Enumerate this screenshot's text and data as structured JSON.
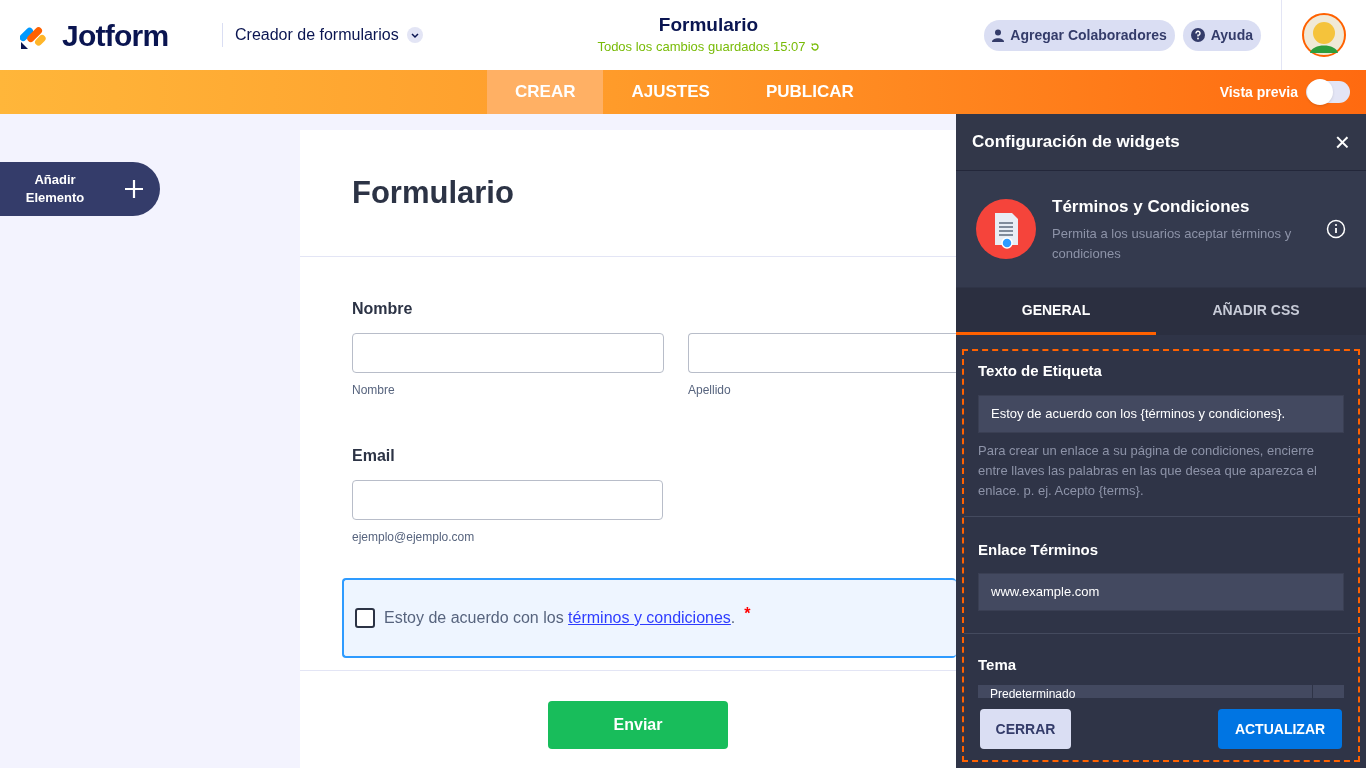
{
  "header": {
    "brand": "Jotform",
    "product": "Creador de formularios",
    "title": "Formulario",
    "save_status": "Todos los cambios guardados 15:07",
    "buttons": [
      "Agregar Colaboradores",
      "Ayuda"
    ]
  },
  "nav": {
    "tabs": [
      {
        "label": "CREAR",
        "selected": true
      },
      {
        "label": "AJUSTES",
        "selected": false
      },
      {
        "label": "PUBLICAR",
        "selected": false
      }
    ],
    "preview": {
      "label": "Vista previa",
      "on": false
    }
  },
  "add_element": {
    "label": "Añadir Elemento"
  },
  "form": {
    "title": "Formulario",
    "name_field": {
      "label": "Nombre",
      "sublabels": [
        "Nombre",
        "Apellido"
      ]
    },
    "email_field": {
      "label": "Email",
      "sublabel": "ejemplo@ejemplo.com"
    },
    "terms": {
      "checked": false,
      "prefix": "Estoy de acuerdo con los ",
      "link": "términos y condiciones",
      "suffix": ".",
      "required_mark": "*"
    },
    "submit": "Enviar"
  },
  "panel": {
    "title": "Configuración de widgets",
    "close": "×",
    "widget_name": "Términos y Condiciones",
    "widget_description": "Permita a los usuarios aceptar términos y condiciones",
    "tabs": [
      {
        "label": "GENERAL",
        "selected": true
      },
      {
        "label": "AÑADIR CSS",
        "selected": false
      }
    ],
    "label_text": {
      "label": "Texto de Etiqueta",
      "value": "Estoy de acuerdo con los {términos y condiciones}.",
      "help": "Para crear un enlace a su página de condiciones, encierre entre llaves las palabras en las que desea que aparezca el enlace. p. ej. Acepto {terms}."
    },
    "terms_link": {
      "label": "Enlace Términos",
      "value": "www.example.com"
    },
    "theme": {
      "label": "Tema",
      "value": "Predeterminado"
    },
    "buttons": [
      {
        "label": "CERRAR",
        "kind": "secondary"
      },
      {
        "label": "ACTUALIZAR",
        "kind": "primary"
      }
    ]
  }
}
